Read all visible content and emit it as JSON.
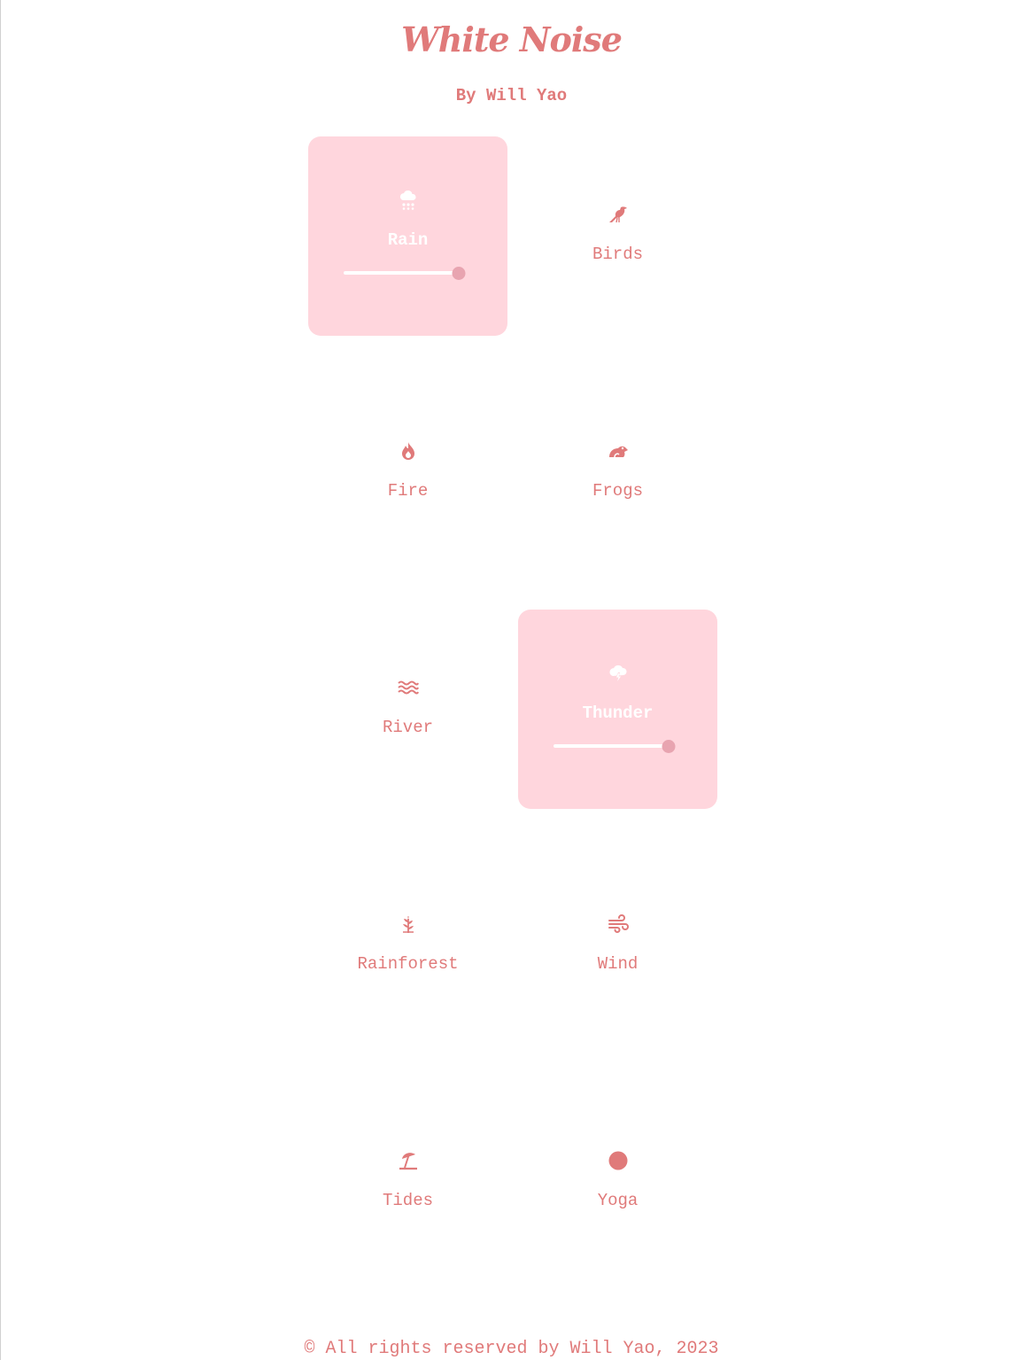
{
  "app": {
    "title": "White Noise",
    "byline": "By Will Yao"
  },
  "sounds": [
    {
      "label": "Rain",
      "icon": "cloud-rain-icon",
      "active": true,
      "volume": 0.95
    },
    {
      "label": "Birds",
      "icon": "crow-icon",
      "active": false
    },
    {
      "label": "Fire",
      "icon": "fire-icon",
      "active": false
    },
    {
      "label": "Frogs",
      "icon": "frog-icon",
      "active": false
    },
    {
      "label": "River",
      "icon": "water-icon",
      "active": false
    },
    {
      "label": "Thunder",
      "icon": "cloud-bolt-icon",
      "active": true,
      "volume": 0.95
    },
    {
      "label": "Rainforest",
      "icon": "leaf-icon",
      "active": false
    },
    {
      "label": "Wind",
      "icon": "wind-icon",
      "active": false
    },
    {
      "label": "Tides",
      "icon": "umbrella-beach-icon",
      "active": false
    },
    {
      "label": "Yoga",
      "icon": "circle-icon",
      "active": false
    }
  ],
  "footer": {
    "text": "© All rights reserved by Will Yao, 2023"
  },
  "colors": {
    "accent": "#e07a7a",
    "active_tile": "#ffd6dd",
    "slider_thumb": "#e8a4b0"
  }
}
